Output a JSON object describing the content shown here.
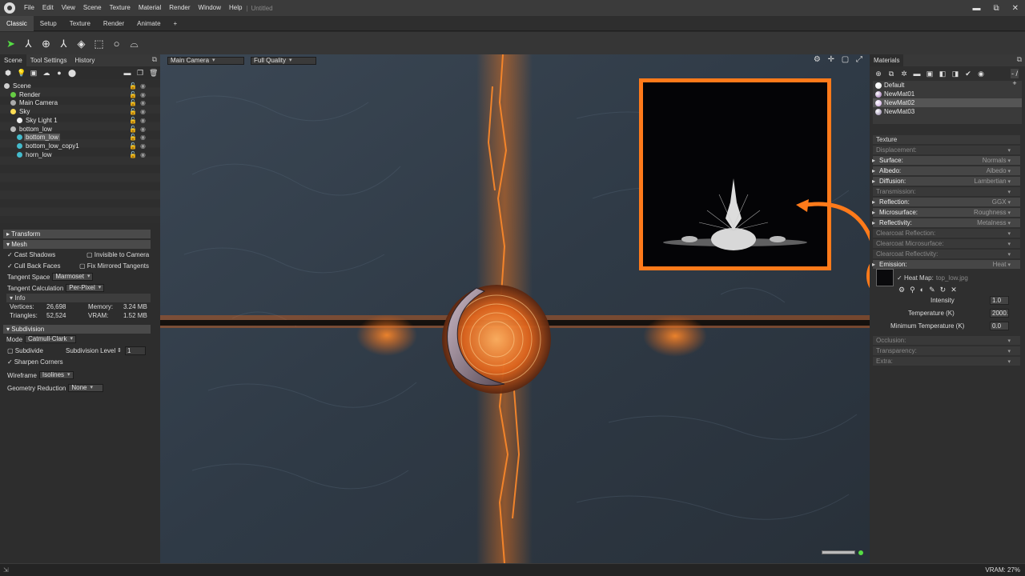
{
  "menu": [
    "File",
    "Edit",
    "View",
    "Scene",
    "Texture",
    "Material",
    "Render",
    "Window",
    "Help"
  ],
  "doc_title": "Untitled",
  "window_controls": {
    "minimize": "▬",
    "maximize": "⧉",
    "close": "✕"
  },
  "workspace_tabs": [
    "Classic",
    "Setup",
    "Texture",
    "Render",
    "Animate",
    "+"
  ],
  "left_tabs": [
    "Scene",
    "Tool Settings",
    "History"
  ],
  "outliner": [
    {
      "label": "Scene",
      "indent": 0,
      "color": "#cfcfcf"
    },
    {
      "label": "Render",
      "indent": 1,
      "color": "#66cc44"
    },
    {
      "label": "Main Camera",
      "indent": 1,
      "color": "#aaaaaa"
    },
    {
      "label": "Sky",
      "indent": 1,
      "color": "#ffdd55"
    },
    {
      "label": "Sky Light 1",
      "indent": 2,
      "color": "#eeeeee"
    },
    {
      "label": "bottom_low",
      "indent": 1,
      "color": "#bbbbbb"
    },
    {
      "label": "bottom_low",
      "indent": 2,
      "color": "#44bbcc"
    },
    {
      "label": "bottom_low_copy1",
      "indent": 2,
      "color": "#44bbcc"
    },
    {
      "label": "horn_low",
      "indent": 2,
      "color": "#44bbcc"
    }
  ],
  "transform": {
    "title": "Transform"
  },
  "mesh": {
    "title": "Mesh",
    "cast_shadows": "Cast Shadows",
    "invisible_to_camera": "Invisible to Camera",
    "cull_back_faces": "Cull Back Faces",
    "fix_mirrored": "Fix Mirrored Tangents",
    "tangent_space_label": "Tangent Space",
    "tangent_space_value": "Marmoset",
    "tangent_calc_label": "Tangent Calculation",
    "tangent_calc_value": "Per-Pixel",
    "info_title": "Info",
    "vertices_label": "Vertices:",
    "vertices": "26,698",
    "memory_label": "Memory:",
    "memory": "3.24 MB",
    "triangles_label": "Triangles:",
    "triangles": "52,524",
    "vram_label": "VRAM:",
    "vram": "1.52 MB"
  },
  "subdivision": {
    "title": "Subdivision",
    "mode_label": "Mode",
    "mode_value": "Catmull-Clark",
    "subdivide": "Subdivide",
    "level_label": "Subdivision Level",
    "level_value": "1",
    "sharpen": "Sharpen Corners",
    "wireframe_label": "Wireframe",
    "wireframe_value": "Isolines",
    "geom_reduction_label": "Geometry Reduction",
    "geom_reduction_value": "None"
  },
  "viewport": {
    "camera": "Main Camera",
    "quality": "Full Quality",
    "icons": "⚙ ✛ ▢ ⤢"
  },
  "materials_tab": "Materials",
  "mat_filter": "- / +",
  "materials": [
    {
      "name": "Default",
      "color": "#e6e6e6"
    },
    {
      "name": "NewMat01",
      "color": "#9a6ab0"
    },
    {
      "name": "NewMat02",
      "color": "#c9a0e0"
    },
    {
      "name": "NewMat03",
      "color": "#8a7aa0"
    }
  ],
  "shader": {
    "texture": "Texture",
    "displacement": {
      "k": "Displacement:",
      "v": ""
    },
    "surface": {
      "k": "Surface:",
      "v": "Normals"
    },
    "albedo": {
      "k": "Albedo:",
      "v": "Albedo"
    },
    "diffusion": {
      "k": "Diffusion:",
      "v": "Lambertian"
    },
    "transmission": {
      "k": "Transmission:",
      "v": ""
    },
    "reflection": {
      "k": "Reflection:",
      "v": "GGX"
    },
    "microsurface": {
      "k": "Microsurface:",
      "v": "Roughness"
    },
    "reflectivity": {
      "k": "Reflectivity:",
      "v": "Metalness"
    },
    "cc_reflection": {
      "k": "Clearcoat Reflection:",
      "v": ""
    },
    "cc_micro": {
      "k": "Clearcoat Microsurface:",
      "v": ""
    },
    "cc_reflectivity": {
      "k": "Clearcoat Reflectivity:",
      "v": ""
    },
    "emission": {
      "k": "Emission:",
      "v": "Heat"
    },
    "heat_map": "Heat Map:",
    "heat_map_file": "top_low.jpg",
    "intensity_label": "Intensity",
    "intensity": "1.0",
    "temperature_label": "Temperature (K)",
    "temperature": "2000.",
    "min_temp_label": "Minimum Temperature (K)",
    "min_temp": "0.0",
    "occlusion": {
      "k": "Occlusion:",
      "v": ""
    },
    "transparency": {
      "k": "Transparency:",
      "v": ""
    },
    "extra": {
      "k": "Extra:",
      "v": ""
    }
  },
  "status": {
    "vram": "VRAM: 27%"
  },
  "accent": "#ff7a1a"
}
